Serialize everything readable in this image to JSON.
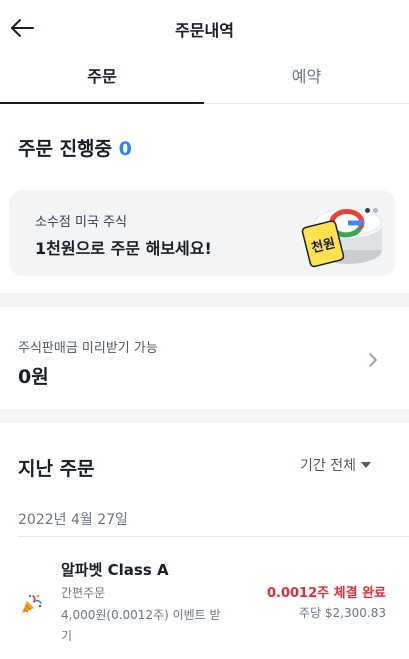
{
  "header": {
    "title": "주문내역",
    "back_icon": "arrow-left-icon"
  },
  "tabs": [
    {
      "label": "주문",
      "active": true
    },
    {
      "label": "예약",
      "active": false
    }
  ],
  "in_progress": {
    "label": "주문 진행중",
    "count": "0"
  },
  "banner": {
    "subtitle": "소수점 미국 주식",
    "title": "1천원으로 주문 해보세요!",
    "badge_text": "천원",
    "page_count": 2,
    "active_page": 1
  },
  "advance": {
    "label": "주식판매금 미리받기 가능",
    "value": "0원"
  },
  "past_orders": {
    "title": "지난 주문",
    "filter_label": "기간 전체",
    "groups": [
      {
        "date": "2022년 4월 27일",
        "orders": [
          {
            "name": "알파벳 Class A",
            "type": "간편주문",
            "detail": "4,000원(0.0012주) 이벤트 받기",
            "status": "0.0012주 체결 완료",
            "unit_price": "주당 $2,300.83",
            "icon": "party-popper-icon"
          }
        ]
      }
    ]
  },
  "colors": {
    "accent_blue": "#3182f6",
    "status_red": "#e42939",
    "text_primary": "#191f28",
    "text_secondary": "#6b7684",
    "section_bg": "#f2f4f6"
  }
}
